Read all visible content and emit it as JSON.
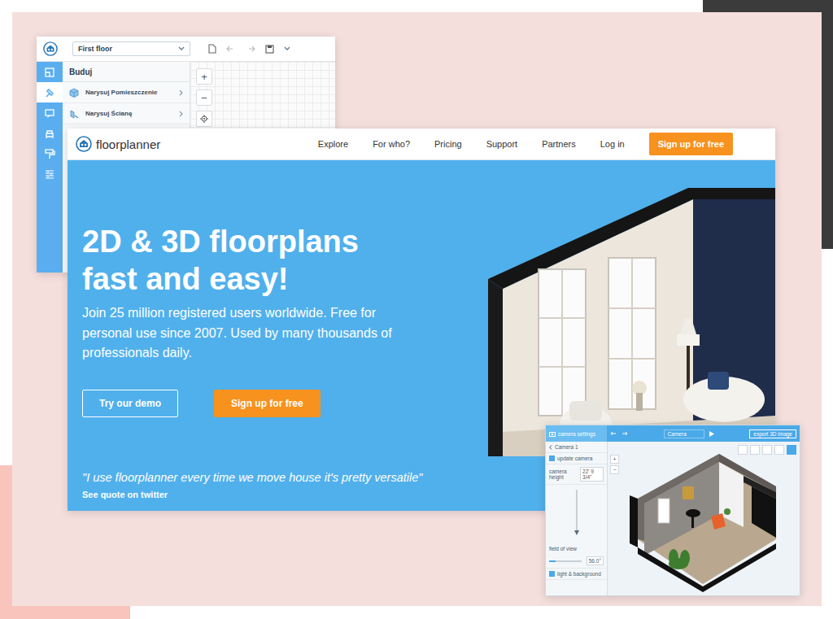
{
  "editor": {
    "floor_select": "First floor",
    "tools": [
      {
        "selected": false
      },
      {
        "selected": true
      },
      {
        "selected": false
      },
      {
        "selected": false
      },
      {
        "selected": false
      },
      {
        "selected": false
      }
    ],
    "panel_title": "Buduj",
    "items": [
      {
        "label": "Narysuj Pomieszczenie"
      },
      {
        "label": "Narysuj Ścianę"
      }
    ],
    "zoom_in": "+",
    "zoom_out": "−"
  },
  "site": {
    "logo": "floorplanner",
    "nav": [
      "Explore",
      "For who?",
      "Pricing",
      "Support",
      "Partners",
      "Log in"
    ],
    "cta": "Sign up for free",
    "headline_lines": [
      "2D & 3D floorplans",
      "fast and easy!"
    ],
    "subtitle": "Join 25 million registered users worldwide. Free for personal use since 2007. Used by many thousands of professionals daily.",
    "demo_button": "Try our demo",
    "signup_button": "Sign up for free",
    "quote": "\"I use floorplanner every time we move house it's pretty versatile\"",
    "quote_link": "See quote on twitter"
  },
  "viewer": {
    "header": "camera settings",
    "view_select": "Camera",
    "export": "export 3D image",
    "camera": "Camera 1",
    "update": "update camera",
    "height_label": "camera height",
    "height_value": "22' 9 3/4\"",
    "fov_label": "field of view",
    "fov_value": "56.0°",
    "fov_level": 0.2,
    "light_label": "light & background",
    "zoom_in": "+",
    "zoom_out": "−"
  }
}
